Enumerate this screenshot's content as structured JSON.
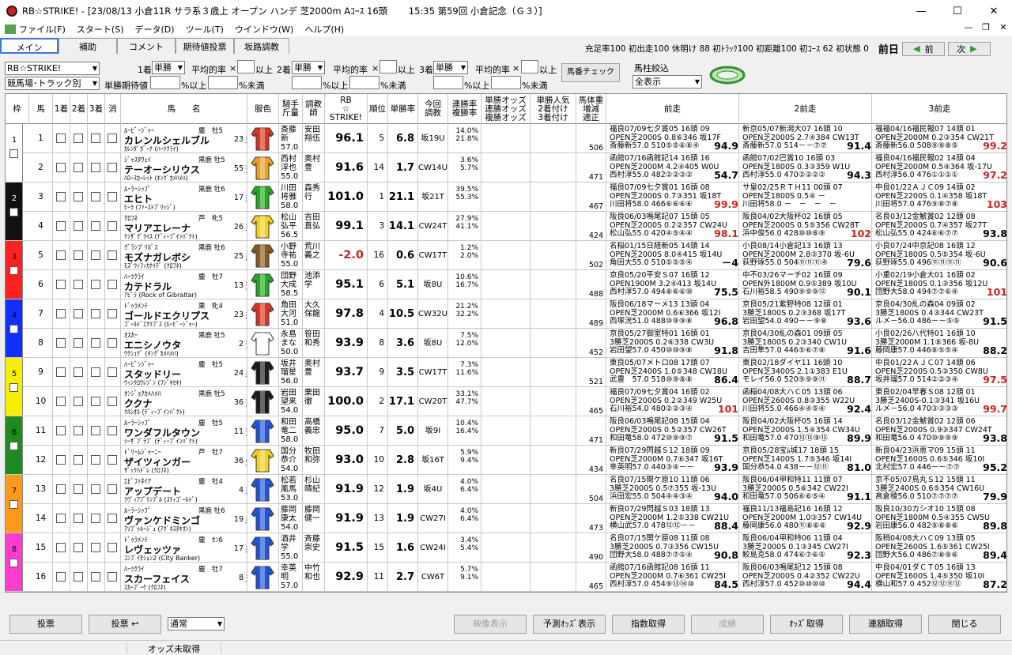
{
  "window": {
    "title": "RB☆STRIKE! - [23/08/13 小倉11R サラ系３歳上 オープン ハンデ 芝2000m Aｺｰｽ 16頭  　　15:35 第59回 小倉記念（Ｇ３）]",
    "min": "—",
    "max": "☐",
    "close": "✕"
  },
  "menu": [
    "ファイル(F)",
    "スタート(S)",
    "データ(D)",
    "ツール(T)",
    "ウインドウ(W)",
    "ヘルプ(H)"
  ],
  "mdi": [
    "—",
    "❐",
    "✕"
  ],
  "tabs": [
    "メイン",
    "補助",
    "コメント",
    "期待値投票",
    "坂路調教"
  ],
  "stats": "充足率100 初出走100 休明け 88 初ﾄﾗｯｸ100 初距離100 初ｺｰｽ 62 初状態 0",
  "nav": {
    "current": "前日",
    "prev": "前",
    "next": "次"
  },
  "filters": {
    "profile": "RB☆STRIKE!",
    "track": "競馬場･トラック別",
    "expected": "単勝期待値",
    "pct_above": "%以上",
    "pct_below": "%未満",
    "avg_rate": "平均的率",
    "above": "以上",
    "times": "×",
    "ticket": "単勝",
    "rank1": "1着",
    "rank2": "2着",
    "rank3": "3着",
    "check_btn": "馬番チェック",
    "filter_label": "馬柱絞込",
    "filter_value": "全表示"
  },
  "headers": {
    "waku": "枠",
    "uma": "馬",
    "c1": "1着",
    "c2": "2着",
    "c3": "3着",
    "kesu": "消",
    "name": "馬　　名",
    "color": "服色",
    "jockey": "騎手\n斤量",
    "trainer": "調教\n師",
    "rb": "RB\n☆\nSTRIKE!",
    "rank": "順位",
    "winrate": "単勝率",
    "konkai": "今回\n調教",
    "rentai": "連勝率\n複勝率",
    "odds": "単勝オッズ\n連勝オッズ\n複勝オッズ",
    "ninki": "単勝人気\n2着付け\n3着付け",
    "weight": "馬体重\n増減\n適正",
    "prev1": "前走",
    "prev2": "2前走",
    "prev3": "3前走"
  },
  "horses": [
    {
      "waku": "1",
      "uma": "1",
      "sire": "ﾙｰﾋﾞｰｼﾞｬｰ",
      "sexage": "塵　牡5",
      "name": "カレンルシェルブル",
      "damsire": "ｶﾚﾝﾀﾞｶﾞｰﾅ (ﾊｰﾂｸﾗｲ)",
      "style": "差",
      "pop": "23",
      "jockey": "斎藤\n新\n57.0",
      "trainer": "安田\n翔伍",
      "score": "96.1",
      "rank": "5",
      "win": "6.8",
      "kon": "坂19U",
      "rate": "14.0%\n21.8%",
      "weight": "506",
      "p1": [
        "福良07/09七夕賞05 16頭 09",
        "OPEN芝2000S 0.8⑥346 坂17F",
        "斎藤新57.0 510⑤⑤⑥⑧④ 94.9"
      ],
      "p2": [
        "新京05/07新潟大07 16頭 10",
        "OPEN芝2000S 2.7④384 CW13T",
        "斎藤新57.0 514－－⑦⑦ 91.4"
      ],
      "p3": [
        "福福04/16福民報07 14頭 01",
        "OPEN芝2000M 0.2③354 CW21T",
        "斎藤新56.0 508⑨⑨⑧⑤ 99.2"
      ],
      "silk": "#dd3322"
    },
    {
      "waku": "1",
      "uma": "2",
      "sire": "ｼﾞｬｽﾀｳｪｲ",
      "sexage": "黒鹿 牡5",
      "name": "テーオーシリウス",
      "damsire": "ﾊﾛｰｽｶｰﾚｯﾄ (ｷﾝｸﾞｶﾒﾊﾒﾊ)",
      "style": "逃",
      "pop": "55",
      "jockey": "西村\n淳也\n55.0",
      "trainer": "奥村\n豊",
      "score": "91.6",
      "rank": "14",
      "win": "1.7",
      "kon": "CW14U",
      "rate": "3.6%\n5.7%",
      "weight": "471",
      "p1": [
        "函館07/16函館記14 16頭 16",
        "OPEN芝2000M 4.2④405 W0U",
        "西村淳55.0 482②②②② 54.7"
      ],
      "p2": [
        "函館07/02巴賞10 16頭 03",
        "OPEN芝1800S 0.3③359 W1U",
        "西村淳55.0 470②②②② 94.3"
      ],
      "p3": [
        "福良04/16福民報02 14頭 04",
        "OPEN芝2000M 0.5④364 坂-17U",
        "西村淳56.0 476①①①① 97.2"
      ],
      "silk": "#e8a020"
    },
    {
      "waku": "2",
      "uma": "3",
      "sire": "ﾙｰﾗｰｼｯﾌﾟ",
      "sexage": "黒鹿 牡6",
      "name": "エヒト",
      "damsire": "ﾋｰﾗ (ﾌｧｰｽﾄﾌﾞﾘｯｼﾞ)",
      "style": "差",
      "pop": "17",
      "jockey": "川田\n将雅\n58.0",
      "trainer": "森秀\n行",
      "score": "101.0",
      "rank": "1",
      "win": "21.1",
      "kon": "坂21T",
      "rate": "39.5%\n55.3%",
      "weight": "467",
      "p1": [
        "福良07/09七夕賞01 16頭 08",
        "OPEN芝2000S 0.7③351 坂18T",
        "川田将58.0 466⑥⑥⑥⑥ 99.9"
      ],
      "p2": [
        "サ皇02/25ＲＴＨ11 00頭 07",
        "OPEN芝1800S 0.5④ －",
        "川田将58.0 －　－　－　－"
      ],
      "p3": [
        "中良01/22ＡＪＣ09 14頭 02",
        "OPEN芝2200S 0.1④358 坂18T",
        "川田将57.0 476⑨⑧⑦⑧ 103"
      ],
      "silk": "#22aa22"
    },
    {
      "waku": "2",
      "uma": "4",
      "sire": "ｸﾛﾌﾈ",
      "sexage": "芦　牝5",
      "name": "マリアエレーナ",
      "damsire": "ﾃﾝｻﾞｸﾞﾗｲｽ (ﾃﾞｨｰﾌﾟｲﾝﾊﾟｸﾄ)",
      "style": "差",
      "pop": "26",
      "jockey": "松山\n弘平\n56.5",
      "trainer": "吉田\n直弘",
      "score": "99.1",
      "rank": "3",
      "win": "14.1",
      "kon": "CW24T",
      "rate": "27.9%\n41.1%",
      "weight": "424",
      "p1": [
        "阪良06/03鳴尾記07 15頭 05",
        "OPEN芝2000S 0.2②357 CW24U",
        "松山弘55.0 420④⑤④④ 98.1"
      ],
      "p2": [
        "阪良04/02大阪杯02 16頭 05",
        "OPEN芝2000S 0.5⑤356 CW28T",
        "浜中俊56.0 428⑩⑩⑧⑨ 102"
      ],
      "p3": [
        "名良03/12金鯱賞02 12頭 08",
        "OPEN芝2000S 0.7④357 坂27T",
        "松山弘55.0 424⑥⑥⑦⑦ 93.8"
      ],
      "silk": "#f0d020"
    },
    {
      "waku": "3",
      "uma": "5",
      "sire": "ｸﾞﾗﾝﾌﾟﾘﾎﾞｽ",
      "sexage": "黒鹿 牡6",
      "name": "モズナガレボシ",
      "damsire": "ﾓｽﾞｳｨﾌｨｶﾅｲﾃﾞ (ｸﾛﾌﾈ)",
      "style": "差",
      "pop": "25",
      "jockey": "小野\n寺祐\n55.0",
      "trainer": "荒川\n義之",
      "score": "-2.0",
      "rank": "16",
      "win": "0.6",
      "kon": "CW17T",
      "rate": "1.2%\n2.0%",
      "weight": "502",
      "p1": [
        "名稲01/15日経新05 14頭 14",
        "OPEN芝2000S 8.0④415 坂14U",
        "角田大55.0 510⑤⑤⑤④ －4"
      ],
      "p2": [
        "小良08/14小倉記13 16頭 13",
        "OPEN芝2000M 2.8③370 坂-6U",
        "荻野琢55.0 504⑪⑪⑪④ 79.6"
      ],
      "p3": [
        "小良07/24中京記08 16頭 12",
        "OPEN芝1800S 0.5⑤354 坂-6U",
        "荻野琢55.0 496⑪⑪⑪⑪ 90.6"
      ],
      "silk": "#8a5a20"
    },
    {
      "waku": "3",
      "uma": "6",
      "sire": "ﾊｰﾂｸﾗｲ",
      "sexage": "塵　牡7",
      "name": "カテドラル",
      "damsire": "ｱﾋﾟﾗ (Rock of Gibraltar)",
      "style": "追",
      "pop": "13",
      "jockey": "団野\n大成\n58.5",
      "trainer": "池添\n学",
      "score": "95.1",
      "rank": "6",
      "win": "5.1",
      "kon": "坂8U",
      "rate": "10.6%\n16.7%",
      "weight": "488",
      "p1": [
        "京良05/20平安Ｓ07 16頭 12",
        "OPEN1900M 3.2④413 坂14U",
        "西村淳57.0 494⑧⑥⑥⑩ 75.5"
      ],
      "p2": [
        "中不03/26マーチ02 16頭 09",
        "OPEN外1800M 0.9⑤389 坂10U",
        "石川裕58.5 490⑨⑨⑨⑫ 90.1"
      ],
      "p3": [
        "小重02/19小倉大01 16頭 02",
        "OPEN芝1800S 0.1③356 坂12U",
        "団野大58.0 494⑦⑦⑥④ 101"
      ],
      "silk": "#22aa22"
    },
    {
      "waku": "4",
      "uma": "7",
      "sire": "ﾄﾞｩﾗﾒﾝﾃ",
      "sexage": "栗　牝4",
      "name": "ゴールドエクリプス",
      "damsire": "ｺﾞｰﾙﾄﾞｴｸﾘﾌﾟｽ (ﾙｰﾋﾞｰｼﾞｬｰ)",
      "style": "差",
      "pop": "23",
      "jockey": "角田\n大河\n51.0",
      "trainer": "大久\n保龍",
      "score": "97.8",
      "rank": "4",
      "win": "10.5",
      "kon": "CW32U",
      "rate": "21.2%\n32.2%",
      "weight": "489",
      "p1": [
        "阪良06/18マーメ13 13頭 04",
        "OPEN芝2000M 0.6⑥366 坂12I",
        "西塚洸51.0 488⑩⑨⑨⑧ 96.8"
      ],
      "p2": [
        "京良05/21紫野特08 12頭 01",
        "3勝芝1800S 0.2③368 坂17T",
        "岩田望54.0 490－－⑨⑧ 93.6"
      ],
      "p3": [
        "京良04/30糺の森04 09頭 02",
        "3勝芝1800S 0.4③344 CW23T",
        "ルメ－56.0 486－－⑤⑤ 91.5"
      ],
      "silk": "#dd3322"
    },
    {
      "waku": "4",
      "uma": "8",
      "sire": "ｵｽｶｰ",
      "sexage": "黒鹿 牡5",
      "name": "エニシノウタ",
      "damsire": "ｳｸｼｭｹﾞ (ｷﾝｸﾞｶﾒﾊﾒﾊ)",
      "style": "追",
      "pop": "2",
      "jockey": "永島\nまな\n50.0",
      "trainer": "笹田\n和秀",
      "score": "93.9",
      "rank": "8",
      "win": "3.6",
      "kon": "坂8U",
      "rate": "7.5%\n12.0%",
      "weight": "452",
      "p1": [
        "京良05/27御室特01 16頭 01",
        "3勝芝2000S 0.2⑥338 CW3U",
        "岩田望57.0 450⑩⑩⑨⑧ 91.8"
      ],
      "p2": [
        "京良04/30糺の森01 09頭 05",
        "3勝芝1800S 0.2③340 CW1U",
        "吉田隼57.0 446⑤⑥⑦⑧ 91.6"
      ],
      "p3": [
        "小良02/26八代特01 16頭 10",
        "3勝芝2000M 1.1⑧366 坂-8U",
        "藤岡康57.0 446⑧⑤⑤④ 88.2"
      ],
      "silk": "#ffffff"
    },
    {
      "waku": "5",
      "uma": "9",
      "sire": "ﾊｰﾋﾞﾝｼﾞｬｰ",
      "sexage": "塵　牡5",
      "name": "スタッドリー",
      "damsire": "ｳｨﾝｸﾛｳﾚｿﾞﾝ (ﾌｼﾞｷｾｷ)",
      "style": "差",
      "pop": "24",
      "jockey": "坂井\n瑠星\n56.0",
      "trainer": "奥村\n豊",
      "score": "93.7",
      "rank": "9",
      "win": "3.5",
      "kon": "CW17T",
      "rate": "7.3%\n11.6%",
      "weight": "521",
      "p1": [
        "東良05/07メトロ08 17頭 07",
        "OPEN芝2400S 1.0⑤348 CW18U",
        "武豊　57.0 518⑩⑨⑧⑧ 86.4"
      ],
      "p2": [
        "東良02/18ダイヤ11 16頭 10",
        "OPEN芝3400S 2.1①383 E1U",
        "モレイ56.0 520⑨⑨⑨⑪ 88.7"
      ],
      "p3": [
        "中良01/22ＡＪＣ07 14頭 06",
        "OPEN芝2200S 0.5③350 CW8U",
        "坂井瑠57.0 514②②③④ 97.5"
      ],
      "silk": "#1a1a1a"
    },
    {
      "waku": "5",
      "uma": "10",
      "sire": "ｵﾝｼﾞｮｸｶﾒﾊﾒﾊ",
      "sexage": "黒鹿 牡5",
      "name": "ククナ",
      "damsire": "ｸﾙｼｵﾙ (ﾃﾞｨｰﾌﾟｲﾝﾊﾟｸﾄ)",
      "style": "逃",
      "pop": "36",
      "jockey": "岩田\n望来\n54.0",
      "trainer": "栗田\n徹",
      "score": "100.0",
      "rank": "2",
      "win": "17.1",
      "kon": "CW20T",
      "rate": "33.1%\n47.7%",
      "weight": "465",
      "p1": [
        "福良07/09七夕賞04 16頭 02",
        "OPEN芝2000S 0.2②349 W25U",
        "石川裕54.0 480②②③④ 101"
      ],
      "p2": [
        "函稲04/08大ハＣ05 13頭 06",
        "OPEN芝2600S 0.8③355 W22U",
        "川田将55.0 466④④⑤④ 92.4"
      ],
      "p3": [
        "東良02/04早春Ｓ08 12頭 01",
        "3勝芝2400S-0.1③341 坂16U",
        "ルメ－56.0 470③③③③ 99.7"
      ],
      "silk": "#1a1a1a"
    },
    {
      "waku": "6",
      "uma": "11",
      "sire": "ﾙｰﾗｰｼｯﾌﾟ",
      "sexage": "塵　牡5",
      "name": "ワンダフルタウン",
      "damsire": "ｼｰｻﾞﾌﾞﾗﾌﾞ (ﾃﾞｨｰﾌﾟｲﾝﾊﾟｸﾄ)",
      "style": "追",
      "pop": "11",
      "jockey": "和田\n竜二\n58.0",
      "trainer": "高橋\n義忠",
      "score": "95.0",
      "rank": "7",
      "win": "5.0",
      "kon": "坂9I",
      "rate": "10.4%\n16.4%",
      "weight": "471",
      "p1": [
        "阪良06/03鳴尾記08 15頭 04",
        "OPEN芝2000S 0.5②357 CW26T",
        "和田竜58.0 472⑩⑨⑨⑦ 91.5"
      ],
      "p2": [
        "阪良04/02大阪杯05 16頭 14",
        "OPEN芝2000S 1.5④354 CW34U",
        "和田竜57.0 470⑬⑬⑨⑬ 89.9"
      ],
      "p3": [
        "名良03/12金鯱賞02 12頭 06",
        "OPEN芝2000S 0.9③347 CW24T",
        "和田竜56.0 470⑩⑨⑨⑨ 93.8"
      ],
      "silk": "#2255dd"
    },
    {
      "waku": "6",
      "uma": "12",
      "sire": "ﾄﾞﾘｰﾑｼﾞｬｰﾆｰ",
      "sexage": "芦　牡7",
      "name": "ザイツィンガー",
      "damsire": "ｻﾞｯｸﾊﾄﾞﾚ (ｸﾛﾌﾈ)",
      "style": "先",
      "pop": "36",
      "jockey": "国分\n恭介\n54.0",
      "trainer": "牧田\n和弥",
      "score": "93.0",
      "rank": "10",
      "win": "2.8",
      "kon": "坂16T",
      "rate": "5.9%\n9.4%",
      "weight": "434",
      "p1": [
        "新良07/29閃越Ｓ12 18頭 09",
        "OPEN芝2000M 0.7⑥347 坂16T",
        "幸英明57.0 440③④－－ 93.9"
      ],
      "p2": [
        "京良05/28宝ﾑ城17 18頭 15",
        "OPEN芝1400S 1.7⑤346 坂14I",
        "国分恭54.0 438－－⑫⑪ 81.0"
      ],
      "p3": [
        "新良04/23浜恵マ09 15頭 11",
        "OPEN芝1600S 0.6⑤346 坂10I",
        "北村宏57.0 446－－⑦⑦ 95.2"
      ],
      "silk": "#f0d020"
    },
    {
      "waku": "7",
      "uma": "13",
      "sire": "ｴﾋﾟﾌｧﾈｲｱ",
      "sexage": "塵　牡4",
      "name": "アップデート",
      "damsire": "ﾗｳﾞｨｱﾌﾟﾘﾝﾌﾞﾙ (ｽﾃｨｺﾞｰﾙﾄﾞ)",
      "style": "差",
      "pop": "4",
      "jockey": "松若\n風馬\n53.0",
      "trainer": "杉山\n晴紀",
      "score": "91.9",
      "rank": "12",
      "win": "1.9",
      "kon": "坂4U",
      "rate": "4.0%\n6.4%",
      "weight": "504",
      "p1": [
        "名良07/15関ケ原10 11頭 06",
        "3勝芝2000S 0.5⑦355 坂-13U",
        "浜田宏55.0 504④④③④ 94.0"
      ],
      "p2": [
        "阪良06/04甲和特11 11頭 07",
        "3勝芝2000S 0.5⑥342 CW22I",
        "和田竜57.0 506⑥⑥⑤④ 91.1"
      ],
      "p3": [
        "京不05/07鳥丸Ｓ12 15頭 11",
        "3勝芝2400S 0.6⑤354 CW16U",
        "高倉稜56.0 510⑦⑦⑦⑦ 79.9"
      ],
      "silk": "#2255dd"
    },
    {
      "waku": "7",
      "uma": "14",
      "sire": "ﾙｰﾗｰｼｯﾌﾟ",
      "sexage": "黒鹿 牡6",
      "name": "ヴァンケドミンゴ",
      "damsire": "ｱｿﾌﾞｩﾙｰｼﾞｭ (ｱｸﾞﾈｽﾀｷｵﾝ)",
      "style": "差",
      "pop": "19",
      "jockey": "藤岡\n康太\n54.0",
      "trainer": "藤岡\n健一",
      "score": "91.9",
      "rank": "13",
      "win": "1.9",
      "kon": "CW27I",
      "rate": "4.0%\n6.4%",
      "weight": "473",
      "p1": [
        "新良07/29閃越Ｓ03 18頭 13",
        "OPEN芝2000M 1.2⑤338 CW21U",
        "横山武57.0 478⑫⑫－－ 88.4"
      ],
      "p2": [
        "福良11/13福島記16 16頭 12",
        "OPEN芝2000M 1.0③357 CW14U",
        "藤岡康56.0 480⑪⑧⑥⑥ 92.9"
      ],
      "p3": [
        "阪良10/30カシオ10 15頭 08",
        "OPEN芝1800M 0.5④355 CW5U",
        "岩田康56.0 482⑨⑧⑧⑥ 89.8"
      ],
      "silk": "#2255dd"
    },
    {
      "waku": "8",
      "uma": "15",
      "sire": "ﾄﾞｩﾗﾒﾝﾃ",
      "sexage": "塵　ｾﾝ6",
      "name": "レヴェッツァ",
      "damsire": "ｺﾝﾌﾞｲﾀｼｮﾝ2 (City Banker)",
      "style": "差",
      "pop": "17",
      "jockey": "酒井\n学\n55.0",
      "trainer": "斉藤\n崇史",
      "score": "91.5",
      "rank": "15",
      "win": "1.6",
      "kon": "CW24I",
      "rate": "3.4%\n5.4%",
      "weight": "490",
      "p1": [
        "名良07/15関ケ原08 11頭 08",
        "3勝芝2000S 0.7③356 CW15U",
        "団野大58.0 488⑦⑦⑤④ 90.8"
      ],
      "p2": [
        "阪良06/04甲和特06 11頭 04",
        "3勝芝2000S 0.1③345 CW27I",
        "鮫島克58.0 474⑥⑦⑥⑤ 92.3"
      ],
      "p3": [
        "阪稍04/08大ハＣ09 13頭 05",
        "OPEN芝2600S 1.6⑤361 CW25I",
        "団野大56.0 486⑦⑧⑨⑥ 89.4"
      ],
      "silk": "#2255dd"
    },
    {
      "waku": "8",
      "uma": "16",
      "sire": "ﾊｰﾂｸﾗｲ",
      "sexage": "塵　牡7",
      "name": "スカーフェイス",
      "damsire": "ｽｶｰﾌﾞｰｹ (ｸﾛﾌﾈ)",
      "style": "追",
      "pop": "8",
      "jockey": "幸英\n明\n57.0",
      "trainer": "中竹\n和也",
      "score": "92.9",
      "rank": "11",
      "win": "2.7",
      "kon": "CW6T",
      "rate": "5.7%\n9.1%",
      "weight": "465",
      "p1": [
        "函館07/16函館記08 16頭 11",
        "OPEN芝2000M 0.7⑥361 CW25I",
        "西村淳57.0 454⑨⑬⑭⑩ 84.5"
      ],
      "p2": [
        "阪良06/03鳴尾記12 15頭 08",
        "OPEN芝2000S 0.4②352 CW22U",
        "西村淳57.0 452⑩⑩⑩⑩ 94.4"
      ],
      "p3": [
        "中良04/01ダＣＴ05 16頭 13",
        "OPEN芝1600S 1.4⑤350 坂10I",
        "横山和57.0 452⑫⑫⑪⑫ 87.2"
      ],
      "silk": "#2255dd"
    }
  ],
  "waku_colors": {
    "1": "#ffffff",
    "2": "#111111",
    "3": "#ff2020",
    "4": "#1030ff",
    "5": "#f6f000",
    "6": "#1f8a1f",
    "7": "#ff9a1a",
    "8": "#ff3cd0"
  },
  "bottom": {
    "vote": "投票",
    "vote2": "投票",
    "mode": "通常",
    "video": "映像表示",
    "pred_odds": "予測ｵｯｽﾞ表示",
    "index": "指数取得",
    "result": "成績",
    "odds": "ｵｯｽﾞ取得",
    "renso": "連額取得",
    "close": "閉じる"
  },
  "status": "オッズ未取得"
}
